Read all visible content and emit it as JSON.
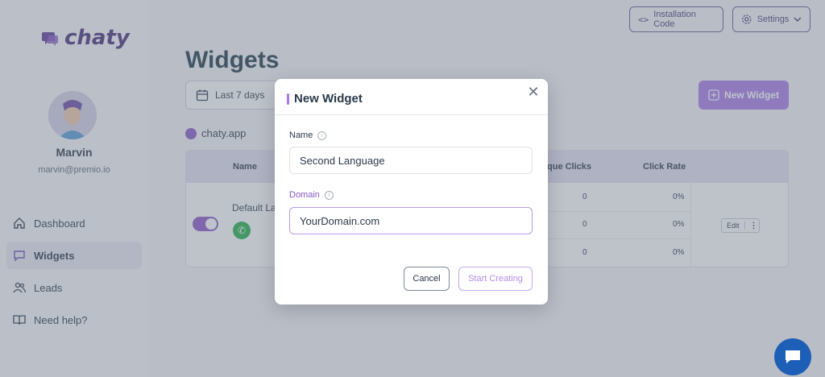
{
  "brand": {
    "name": "chaty"
  },
  "user": {
    "name": "Marvin",
    "email": "marvin@premio.io"
  },
  "nav": [
    {
      "label": "Dashboard",
      "icon": "home-icon",
      "active": false
    },
    {
      "label": "Widgets",
      "icon": "chat-icon",
      "active": true
    },
    {
      "label": "Leads",
      "icon": "users-icon",
      "active": false
    },
    {
      "label": "Need help?",
      "icon": "book-icon",
      "active": false
    }
  ],
  "header": {
    "installation_code": "Installation Code",
    "settings": "Settings"
  },
  "page": {
    "title": "Widgets",
    "date_range": "Last 7 days",
    "new_widget": "New Widget",
    "site": "chaty.app"
  },
  "table": {
    "headers": {
      "name": "Name",
      "unique_clicks": "que Clicks",
      "click_rate": "Click Rate"
    },
    "widget_name": "Default La",
    "rows": [
      {
        "clicks": "0",
        "rate": "0%"
      },
      {
        "clicks": "0",
        "rate": "0%"
      },
      {
        "clicks": "0",
        "rate": "0%"
      }
    ],
    "edit_label": "Edit"
  },
  "modal": {
    "title": "New Widget",
    "name_label": "Name",
    "name_value": "Second Language",
    "domain_label": "Domain",
    "domain_value": "YourDomain.com",
    "cancel": "Cancel",
    "start": "Start Creating"
  },
  "colors": {
    "accent": "#a87be8",
    "brand_dark": "#4a2f7a",
    "chat_bubble": "#1d5fb6"
  }
}
